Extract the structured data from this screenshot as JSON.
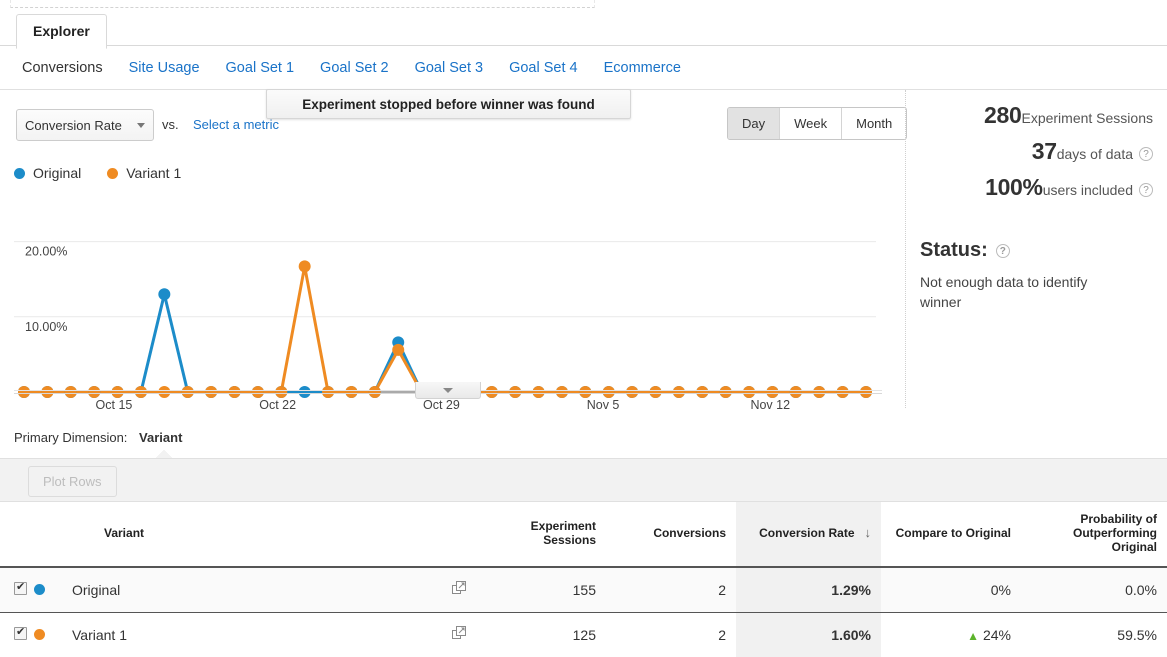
{
  "tab": {
    "label": "Explorer"
  },
  "subnav": [
    {
      "label": "Conversions",
      "active": true
    },
    {
      "label": "Site Usage",
      "active": false
    },
    {
      "label": "Goal Set 1",
      "active": false
    },
    {
      "label": "Goal Set 2",
      "active": false
    },
    {
      "label": "Goal Set 3",
      "active": false
    },
    {
      "label": "Goal Set 4",
      "active": false
    },
    {
      "label": "Ecommerce",
      "active": false
    }
  ],
  "metric_selector": {
    "selected": "Conversion Rate",
    "vs_label": "vs.",
    "secondary_link": "Select a metric"
  },
  "callout": {
    "text": "Experiment stopped before winner was found"
  },
  "granularity": {
    "options": [
      "Day",
      "Week",
      "Month"
    ],
    "selected": "Day"
  },
  "summary": {
    "sessions_value": "280",
    "sessions_label": "Experiment Sessions",
    "days_value": "37",
    "days_label": "days of data",
    "users_value": "100%",
    "users_label": "users included",
    "status_heading": "Status:",
    "status_text": "Not enough data to identify winner",
    "help_glyph": "?"
  },
  "chart_data": {
    "type": "line",
    "title": "",
    "xlabel": "",
    "ylabel": "Conversion Rate",
    "ylim": [
      0,
      23
    ],
    "yticks": [
      10,
      20
    ],
    "ytick_labels": [
      "10.00%",
      "20.00%"
    ],
    "grid": true,
    "legend_position": "top-left",
    "x": [
      "Oct 11",
      "Oct 12",
      "Oct 13",
      "Oct 14",
      "Oct 15",
      "Oct 16",
      "Oct 17",
      "Oct 18",
      "Oct 19",
      "Oct 20",
      "Oct 21",
      "Oct 22",
      "Oct 23",
      "Oct 24",
      "Oct 25",
      "Oct 26",
      "Oct 27",
      "Oct 28",
      "Oct 29",
      "Oct 30",
      "Oct 31",
      "Nov 1",
      "Nov 2",
      "Nov 3",
      "Nov 4",
      "Nov 5",
      "Nov 6",
      "Nov 7",
      "Nov 8",
      "Nov 9",
      "Nov 10",
      "Nov 11",
      "Nov 12",
      "Nov 13",
      "Nov 14",
      "Nov 15",
      "Nov 16"
    ],
    "xtick_labels": [
      "Oct 15",
      "Oct 22",
      "Oct 29",
      "Nov 5",
      "Nov 12"
    ],
    "xtick_indices": [
      4,
      11,
      18,
      25,
      32
    ],
    "series": [
      {
        "name": "Original",
        "color": "#1c8cc9",
        "values": [
          0,
          0,
          0,
          0,
          0,
          0,
          13.0,
          0,
          0,
          0,
          0,
          0,
          0,
          0,
          0,
          0,
          6.6,
          0,
          0,
          0,
          0,
          0,
          0,
          0,
          0,
          0,
          0,
          0,
          0,
          0,
          0,
          0,
          0,
          0,
          0,
          0,
          0
        ]
      },
      {
        "name": "Variant 1",
        "color": "#ef8b22",
        "values": [
          0,
          0,
          0,
          0,
          0,
          0,
          0,
          0,
          0,
          0,
          0,
          0,
          16.7,
          0,
          0,
          0,
          5.6,
          0,
          0,
          0,
          0,
          0,
          0,
          0,
          0,
          0,
          0,
          0,
          0,
          0,
          0,
          0,
          0,
          0,
          0,
          0,
          0
        ]
      }
    ]
  },
  "chart_controls": {
    "collapse_title": "Collapse chart"
  },
  "primary_dimension": {
    "label": "Primary Dimension:",
    "value": "Variant"
  },
  "plot_rows_button": {
    "label": "Plot Rows"
  },
  "table": {
    "columns": [
      "Variant",
      "Experiment Sessions",
      "Conversions",
      "Conversion Rate",
      "Compare to Original",
      "Probability of Outperforming Original"
    ],
    "sorted_column": "Conversion Rate",
    "sort_direction": "desc",
    "sort_glyph": "↓",
    "rows": [
      {
        "checked": true,
        "color": "#1c8cc9",
        "variant": "Original",
        "sessions": "155",
        "conversions": "2",
        "conversion_rate": "1.29%",
        "compare": "0%",
        "compare_direction": "none",
        "probability": "0.0%"
      },
      {
        "checked": true,
        "color": "#ef8b22",
        "variant": "Variant 1",
        "sessions": "125",
        "conversions": "2",
        "conversion_rate": "1.60%",
        "compare": "24%",
        "compare_direction": "up",
        "probability": "59.5%"
      }
    ]
  }
}
